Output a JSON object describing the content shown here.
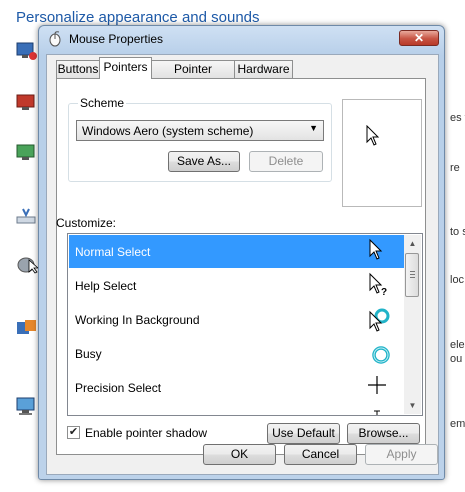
{
  "background": {
    "title": "Personalize appearance and sounds",
    "fragments": [
      "es t",
      "re",
      "to s",
      "loc",
      "ele",
      "ou",
      "em"
    ]
  },
  "window": {
    "title": "Mouse Properties",
    "close_glyph": "✕"
  },
  "tabs": [
    "Buttons",
    "Pointers",
    "Pointer Options",
    "Hardware"
  ],
  "active_tab": "Pointers",
  "scheme": {
    "label": "Scheme",
    "selected": "Windows Aero (system scheme)",
    "save_as": "Save As...",
    "delete": "Delete"
  },
  "customize": {
    "label": "Customize:",
    "items": [
      {
        "name": "Normal Select",
        "cursor_icon": "arrow-cursor-icon",
        "selected": true
      },
      {
        "name": "Help Select",
        "cursor_icon": "help-cursor-icon",
        "selected": false
      },
      {
        "name": "Working In Background",
        "cursor_icon": "working-cursor-icon",
        "selected": false
      },
      {
        "name": "Busy",
        "cursor_icon": "busy-ring-icon",
        "selected": false
      },
      {
        "name": "Precision Select",
        "cursor_icon": "crosshair-icon",
        "selected": false
      },
      {
        "name": "",
        "cursor_icon": "text-select-icon",
        "selected": false
      }
    ]
  },
  "pointer_shadow": {
    "label": "Enable pointer shadow",
    "checked": true,
    "check_glyph": "✔"
  },
  "buttons": {
    "use_default": "Use Default",
    "browse": "Browse...",
    "ok": "OK",
    "cancel": "Cancel",
    "apply": "Apply"
  },
  "colors": {
    "selection": "#3399ff",
    "title_text": "#1e5aa8",
    "busy_ring": "#21b3c8"
  }
}
